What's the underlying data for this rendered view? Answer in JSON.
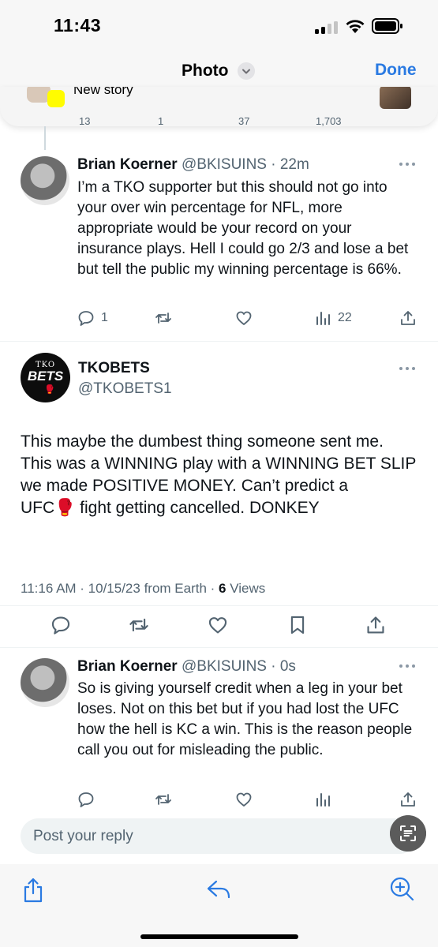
{
  "status_bar": {
    "time": "11:43"
  },
  "header": {
    "title": "Photo",
    "done_label": "Done"
  },
  "share_strip": {
    "label": "New story",
    "partial_counts": [
      "13",
      "1",
      "37",
      "1,703"
    ]
  },
  "reply_1": {
    "name": "Brian Koerner",
    "handle_time": "@BKISUINS · 22m",
    "body": "I’m a TKO supporter but this should not go into your over win percentage for NFL, more appropriate would be your record on your insurance plays.  Hell I could go 2/3 and lose a bet but tell the public my winning percentage is 66%.",
    "replies": "1",
    "views": "22"
  },
  "main_tweet": {
    "name": "TKOBETS",
    "handle": "@TKOBETS1",
    "avatar_text_top": "TKO",
    "avatar_text_main": "BETS",
    "body": "This maybe the dumbest thing someone sent me. This was a WINNING play with a WINNING BET SLIP we made POSITIVE MONEY. Can’t predict a\nUFC🥊 fight getting cancelled. DONKEY",
    "meta_prefix": "11:16 AM · 10/15/23 from Earth · ",
    "views_count": "6",
    "views_label": " Views"
  },
  "reply_2": {
    "name": "Brian Koerner",
    "handle_time": "@BKISUINS · 0s",
    "body": "So is giving yourself credit when a leg in your bet loses.  Not on this bet but if you had lost the UFC how the hell is KC a win.  This is the reason people call you out for misleading the public."
  },
  "reply_box": {
    "placeholder": "Post your reply"
  },
  "colors": {
    "accent": "#1d9bf0",
    "ios_blue": "#2a7ae2",
    "muted": "#536471"
  },
  "icons": [
    "reply-icon",
    "retweet-icon",
    "like-icon",
    "views-icon",
    "share-icon",
    "bookmark-icon",
    "more-icon",
    "scan-text-icon",
    "ios-share-icon",
    "reply-back-icon",
    "zoom-icon"
  ]
}
